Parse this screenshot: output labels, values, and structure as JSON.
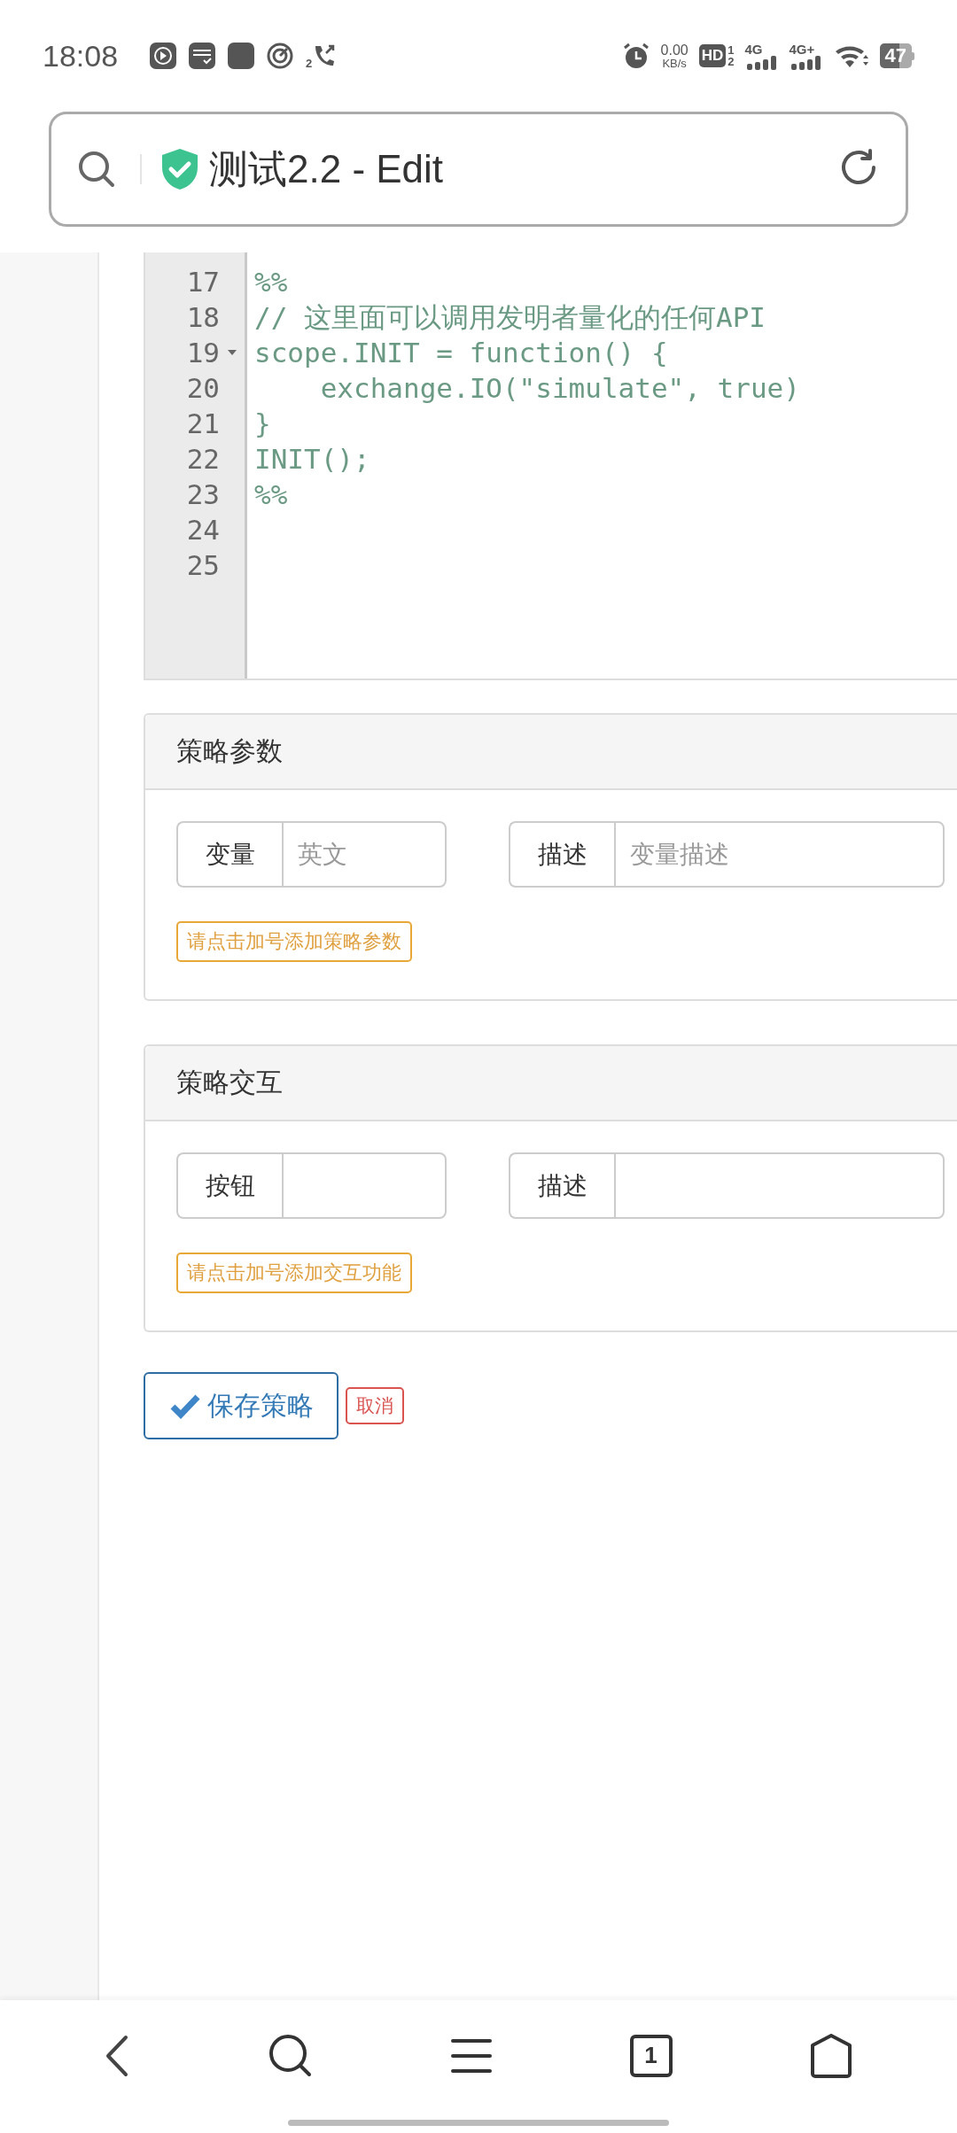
{
  "status_bar": {
    "time": "18:08",
    "call_sim": "2",
    "speed_value": "0.00",
    "speed_unit": "KB/s",
    "hd_label": "HD",
    "hd_sims": [
      "1",
      "2"
    ],
    "networks": [
      "4G",
      "4G+"
    ],
    "battery": "47"
  },
  "address_bar": {
    "title": "测试2.2 - Edit"
  },
  "editor": {
    "lines": [
      {
        "number": "17",
        "code": "%%",
        "foldable": false
      },
      {
        "number": "18",
        "code": "// 这里面可以调用发明者量化的任何API",
        "foldable": false
      },
      {
        "number": "19",
        "code": "scope.INIT = function() {",
        "foldable": true
      },
      {
        "number": "20",
        "code": "    exchange.IO(\"simulate\", true)",
        "foldable": false
      },
      {
        "number": "21",
        "code": "}",
        "foldable": false
      },
      {
        "number": "22",
        "code": "INIT();",
        "foldable": false
      },
      {
        "number": "23",
        "code": "%%",
        "foldable": false
      },
      {
        "number": "24",
        "foldable": false
      },
      {
        "number": "25",
        "foldable": false
      }
    ]
  },
  "panels": [
    {
      "title": "策略参数",
      "fields": [
        {
          "label": "变量",
          "placeholder": "英文"
        },
        {
          "label": "描述",
          "placeholder": "变量描述"
        }
      ],
      "hint": "请点击加号添加策略参数"
    },
    {
      "title": "策略交互",
      "fields": [
        {
          "label": "按钮"
        },
        {
          "label": "描述"
        }
      ],
      "hint": "请点击加号添加交互功能"
    }
  ],
  "actions": {
    "save": "保存策略",
    "cancel": "取消"
  },
  "bottom_nav": {
    "tab_count": "1"
  }
}
